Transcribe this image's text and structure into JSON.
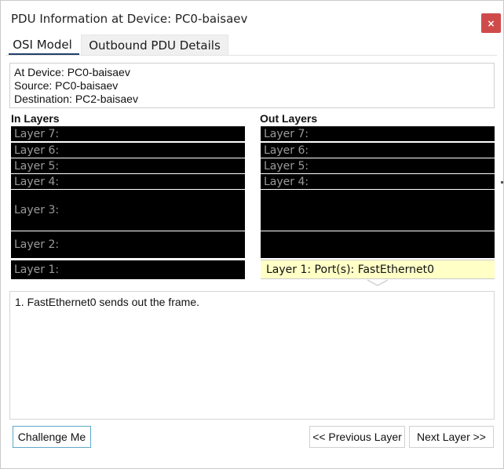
{
  "window": {
    "title": "PDU Information at Device: PC0-baisaev",
    "close_label": "×"
  },
  "tabs": [
    {
      "label": "OSI Model",
      "selected": true
    },
    {
      "label": "Outbound PDU Details",
      "selected": false
    }
  ],
  "info": {
    "device": "At Device: PC0-baisaev",
    "source": "Source: PC0-baisaev",
    "destination": "Destination: PC2-baisaev"
  },
  "in_layers": {
    "header": "In Layers",
    "items": [
      "Layer 7:",
      "Layer 6:",
      "Layer 5:",
      "Layer 4:",
      "Layer 3:",
      "Layer 2:",
      "Layer 1:"
    ]
  },
  "out_layers": {
    "header": "Out Layers",
    "items": [
      "Layer 7:",
      "Layer 6:",
      "Layer 5:",
      "Layer 4:",
      "",
      "",
      "Layer 1: Port(s): FastEthernet0"
    ]
  },
  "description": "1. FastEthernet0 sends out the frame.",
  "buttons": {
    "challenge": "Challenge Me",
    "previous": "<< Previous Layer",
    "next": "Next Layer >>"
  },
  "colors": {
    "close_button": "#cf4b4b",
    "layer_background": "#000000",
    "highlight_layer": "#ffffc6",
    "tab_underline": "#1f3f6a"
  }
}
